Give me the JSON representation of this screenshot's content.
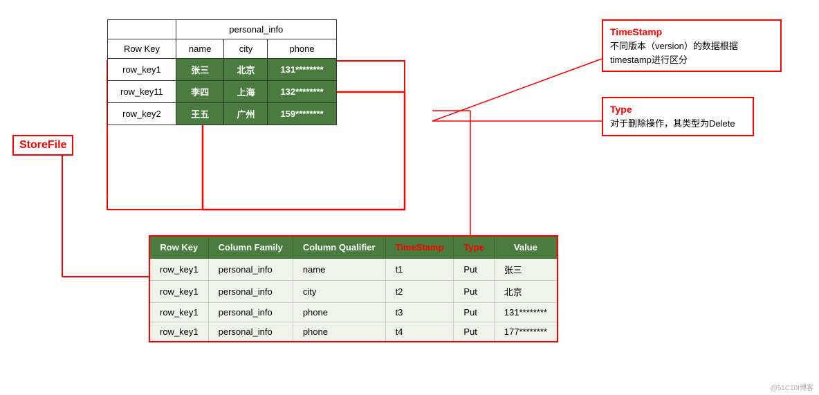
{
  "storefile": {
    "label": "StoreFile"
  },
  "topTable": {
    "personalInfo": "personal_info",
    "headers": [
      "Row Key",
      "name",
      "city",
      "phone"
    ],
    "rows": [
      {
        "key": "row_key1",
        "name": "张三",
        "city": "北京",
        "phone": "131********"
      },
      {
        "key": "row_key11",
        "name": "李四",
        "city": "上海",
        "phone": "132********"
      },
      {
        "key": "row_key2",
        "name": "王五",
        "city": "广州",
        "phone": "159********"
      }
    ]
  },
  "bottomTable": {
    "headers": [
      "Row Key",
      "Column Family",
      "Column Qualifier",
      "TimeStamp",
      "Type",
      "Value"
    ],
    "rows": [
      {
        "rowKey": "row_key1",
        "family": "personal_info",
        "qualifier": "name",
        "timestamp": "t1",
        "type": "Put",
        "value": "张三"
      },
      {
        "rowKey": "row_key1",
        "family": "personal_info",
        "qualifier": "city",
        "timestamp": "t2",
        "type": "Put",
        "value": "北京"
      },
      {
        "rowKey": "row_key1",
        "family": "personal_info",
        "qualifier": "phone",
        "timestamp": "t3",
        "type": "Put",
        "value": "131********"
      },
      {
        "rowKey": "row_key1",
        "family": "personal_info",
        "qualifier": "phone",
        "timestamp": "t4",
        "type": "Put",
        "value": "177********"
      }
    ]
  },
  "annotations": {
    "timestamp": {
      "title": "TimeStamp",
      "body": "不同版本（version）的数据根据timestamp进行区分"
    },
    "type": {
      "title": "Type",
      "body": "对于删除操作，其类型为Delete"
    }
  },
  "watermark": "@51C10I博客"
}
